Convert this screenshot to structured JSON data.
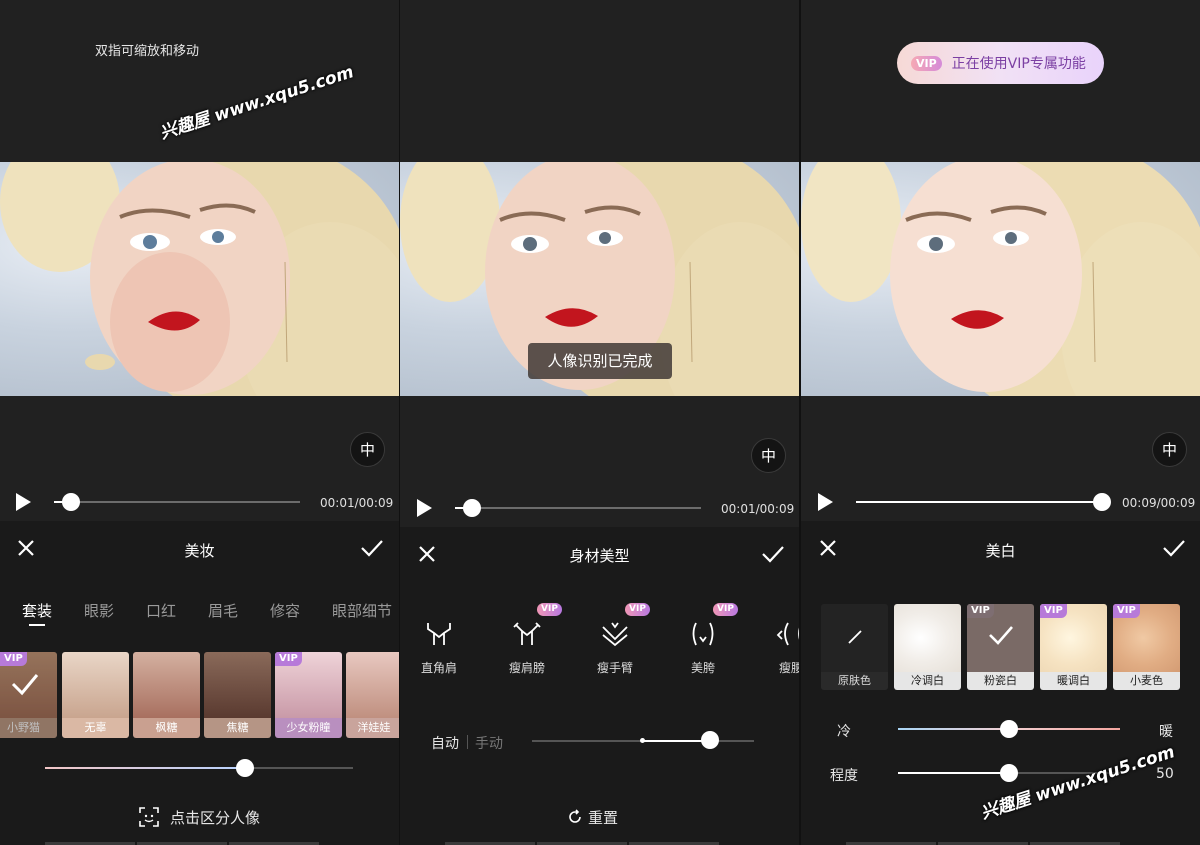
{
  "panel1": {
    "hint": "双指可缩放和移动",
    "watermark": "兴趣屋 www.xqu5.com",
    "time": "00:01/00:09",
    "progress": 0.07,
    "title": "美妆",
    "tabs": [
      "套装",
      "眼影",
      "口红",
      "眉毛",
      "修容",
      "眼部细节"
    ],
    "active_tab": 0,
    "looks": [
      {
        "label": "小野猫",
        "vip": true,
        "selected": true
      },
      {
        "label": "无辜",
        "vip": false
      },
      {
        "label": "枫糖",
        "vip": false
      },
      {
        "label": "焦糖",
        "vip": false
      },
      {
        "label": "少女粉瞳",
        "vip": true
      },
      {
        "label": "洋娃娃",
        "vip": false
      }
    ],
    "intensity": 0.65,
    "action": "点击区分人像"
  },
  "panel2": {
    "toast": "人像识别已完成",
    "time": "00:01/00:09",
    "progress": 0.07,
    "title": "身材美型",
    "items": [
      {
        "label": "直角肩",
        "vip": false
      },
      {
        "label": "瘦肩膀",
        "vip": true
      },
      {
        "label": "瘦手臂",
        "vip": true
      },
      {
        "label": "美胯",
        "vip": true
      },
      {
        "label": "瘦腰",
        "vip": false
      }
    ],
    "mode_auto": "自动",
    "mode_manual": "手动",
    "level": 0.8,
    "reset": "重置"
  },
  "panel3": {
    "vip_badge": "VIP",
    "vip_banner": "正在使用VIP专属功能",
    "watermark": "兴趣屋 www.xqu5.com",
    "time": "00:09/00:09",
    "progress": 1.0,
    "title": "美白",
    "swatches": [
      {
        "label": "原肤色",
        "vip": false
      },
      {
        "label": "冷调白",
        "vip": false
      },
      {
        "label": "粉瓷白",
        "vip": true,
        "selected": true
      },
      {
        "label": "暖调白",
        "vip": true
      },
      {
        "label": "小麦色",
        "vip": true
      }
    ],
    "cold": "冷",
    "warm": "暖",
    "degree": "程度",
    "degree_value": "50",
    "tone": 0.5,
    "degree_level": 0.5
  },
  "labels": {
    "vip": "VIP",
    "compare_glyph": "中"
  },
  "colors": {
    "bg": "#212121",
    "panel_bottom": "#1a1a1a",
    "vip": "#b77ad9",
    "lip": "#c2151e"
  }
}
